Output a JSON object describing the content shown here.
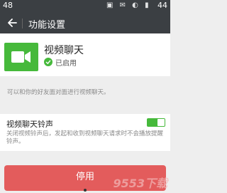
{
  "status_bar": {
    "time_left": "48",
    "time_right": "44",
    "icons_text": "▣ ✉ ◐ ▮"
  },
  "header": {
    "title": "功能设置"
  },
  "plugin": {
    "name": "视频聊天",
    "status": "已启用"
  },
  "description": "可以和你的好友面对面进行视频聊天。",
  "ringtone": {
    "label": "视频聊天铃声",
    "description": "关闭视频铃声后，发起和收到视频聊天请求时不会播放提醒铃声。",
    "enabled": true
  },
  "action": {
    "disable_label": "停用"
  },
  "watermark": "9553下载",
  "colors": {
    "accent": "#46b93b",
    "danger": "#e35c5c",
    "header_bg": "#3b3f43"
  }
}
